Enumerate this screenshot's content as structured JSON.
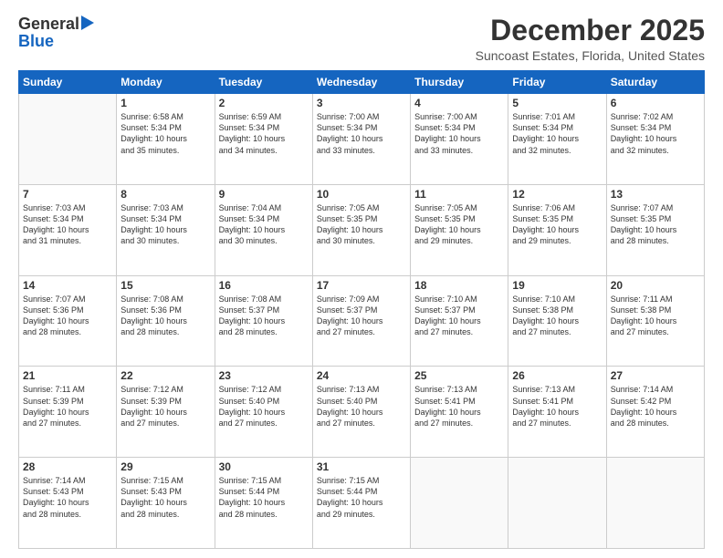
{
  "header": {
    "logo_general": "General",
    "logo_blue": "Blue",
    "month_title": "December 2025",
    "location": "Suncoast Estates, Florida, United States"
  },
  "weekdays": [
    "Sunday",
    "Monday",
    "Tuesday",
    "Wednesday",
    "Thursday",
    "Friday",
    "Saturday"
  ],
  "weeks": [
    [
      {
        "day": "",
        "info": ""
      },
      {
        "day": "1",
        "info": "Sunrise: 6:58 AM\nSunset: 5:34 PM\nDaylight: 10 hours\nand 35 minutes."
      },
      {
        "day": "2",
        "info": "Sunrise: 6:59 AM\nSunset: 5:34 PM\nDaylight: 10 hours\nand 34 minutes."
      },
      {
        "day": "3",
        "info": "Sunrise: 7:00 AM\nSunset: 5:34 PM\nDaylight: 10 hours\nand 33 minutes."
      },
      {
        "day": "4",
        "info": "Sunrise: 7:00 AM\nSunset: 5:34 PM\nDaylight: 10 hours\nand 33 minutes."
      },
      {
        "day": "5",
        "info": "Sunrise: 7:01 AM\nSunset: 5:34 PM\nDaylight: 10 hours\nand 32 minutes."
      },
      {
        "day": "6",
        "info": "Sunrise: 7:02 AM\nSunset: 5:34 PM\nDaylight: 10 hours\nand 32 minutes."
      }
    ],
    [
      {
        "day": "7",
        "info": "Sunrise: 7:03 AM\nSunset: 5:34 PM\nDaylight: 10 hours\nand 31 minutes."
      },
      {
        "day": "8",
        "info": "Sunrise: 7:03 AM\nSunset: 5:34 PM\nDaylight: 10 hours\nand 30 minutes."
      },
      {
        "day": "9",
        "info": "Sunrise: 7:04 AM\nSunset: 5:34 PM\nDaylight: 10 hours\nand 30 minutes."
      },
      {
        "day": "10",
        "info": "Sunrise: 7:05 AM\nSunset: 5:35 PM\nDaylight: 10 hours\nand 30 minutes."
      },
      {
        "day": "11",
        "info": "Sunrise: 7:05 AM\nSunset: 5:35 PM\nDaylight: 10 hours\nand 29 minutes."
      },
      {
        "day": "12",
        "info": "Sunrise: 7:06 AM\nSunset: 5:35 PM\nDaylight: 10 hours\nand 29 minutes."
      },
      {
        "day": "13",
        "info": "Sunrise: 7:07 AM\nSunset: 5:35 PM\nDaylight: 10 hours\nand 28 minutes."
      }
    ],
    [
      {
        "day": "14",
        "info": "Sunrise: 7:07 AM\nSunset: 5:36 PM\nDaylight: 10 hours\nand 28 minutes."
      },
      {
        "day": "15",
        "info": "Sunrise: 7:08 AM\nSunset: 5:36 PM\nDaylight: 10 hours\nand 28 minutes."
      },
      {
        "day": "16",
        "info": "Sunrise: 7:08 AM\nSunset: 5:37 PM\nDaylight: 10 hours\nand 28 minutes."
      },
      {
        "day": "17",
        "info": "Sunrise: 7:09 AM\nSunset: 5:37 PM\nDaylight: 10 hours\nand 27 minutes."
      },
      {
        "day": "18",
        "info": "Sunrise: 7:10 AM\nSunset: 5:37 PM\nDaylight: 10 hours\nand 27 minutes."
      },
      {
        "day": "19",
        "info": "Sunrise: 7:10 AM\nSunset: 5:38 PM\nDaylight: 10 hours\nand 27 minutes."
      },
      {
        "day": "20",
        "info": "Sunrise: 7:11 AM\nSunset: 5:38 PM\nDaylight: 10 hours\nand 27 minutes."
      }
    ],
    [
      {
        "day": "21",
        "info": "Sunrise: 7:11 AM\nSunset: 5:39 PM\nDaylight: 10 hours\nand 27 minutes."
      },
      {
        "day": "22",
        "info": "Sunrise: 7:12 AM\nSunset: 5:39 PM\nDaylight: 10 hours\nand 27 minutes."
      },
      {
        "day": "23",
        "info": "Sunrise: 7:12 AM\nSunset: 5:40 PM\nDaylight: 10 hours\nand 27 minutes."
      },
      {
        "day": "24",
        "info": "Sunrise: 7:13 AM\nSunset: 5:40 PM\nDaylight: 10 hours\nand 27 minutes."
      },
      {
        "day": "25",
        "info": "Sunrise: 7:13 AM\nSunset: 5:41 PM\nDaylight: 10 hours\nand 27 minutes."
      },
      {
        "day": "26",
        "info": "Sunrise: 7:13 AM\nSunset: 5:41 PM\nDaylight: 10 hours\nand 27 minutes."
      },
      {
        "day": "27",
        "info": "Sunrise: 7:14 AM\nSunset: 5:42 PM\nDaylight: 10 hours\nand 28 minutes."
      }
    ],
    [
      {
        "day": "28",
        "info": "Sunrise: 7:14 AM\nSunset: 5:43 PM\nDaylight: 10 hours\nand 28 minutes."
      },
      {
        "day": "29",
        "info": "Sunrise: 7:15 AM\nSunset: 5:43 PM\nDaylight: 10 hours\nand 28 minutes."
      },
      {
        "day": "30",
        "info": "Sunrise: 7:15 AM\nSunset: 5:44 PM\nDaylight: 10 hours\nand 28 minutes."
      },
      {
        "day": "31",
        "info": "Sunrise: 7:15 AM\nSunset: 5:44 PM\nDaylight: 10 hours\nand 29 minutes."
      },
      {
        "day": "",
        "info": ""
      },
      {
        "day": "",
        "info": ""
      },
      {
        "day": "",
        "info": ""
      }
    ]
  ]
}
